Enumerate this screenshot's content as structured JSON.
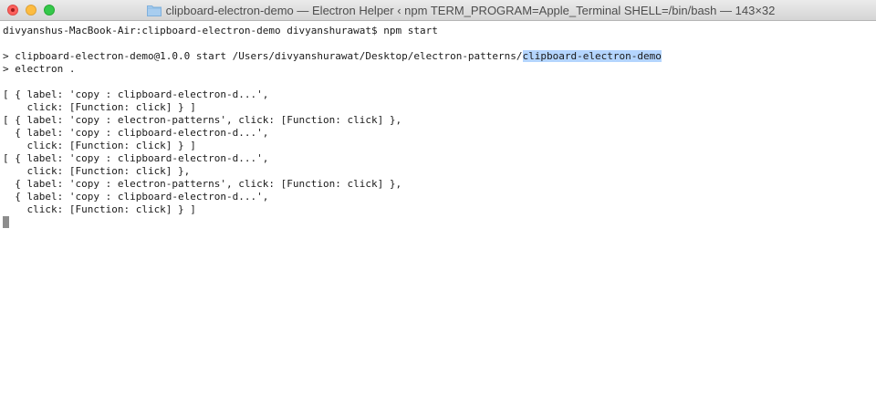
{
  "window": {
    "title": "clipboard-electron-demo — Electron Helper ‹ npm TERM_PROGRAM=Apple_Terminal SHELL=/bin/bash — 143×32"
  },
  "terminal": {
    "prompt_line": "divyanshus-MacBook-Air:clipboard-electron-demo divyanshurawat$ npm start",
    "start_prefix": "> clipboard-electron-demo@1.0.0 start /Users/divyanshurawat/Desktop/electron-patterns/",
    "start_highlight": "clipboard-electron-demo",
    "electron_line": "> electron .",
    "output": [
      "[ { label: 'copy : clipboard-electron-d...',",
      "    click: [Function: click] } ]",
      "[ { label: 'copy : electron-patterns', click: [Function: click] },",
      "  { label: 'copy : clipboard-electron-d...',",
      "    click: [Function: click] } ]",
      "[ { label: 'copy : clipboard-electron-d...',",
      "    click: [Function: click] },",
      "  { label: 'copy : electron-patterns', click: [Function: click] },",
      "  { label: 'copy : clipboard-electron-d...',",
      "    click: [Function: click] } ]"
    ]
  },
  "colors": {
    "selection": "#b4d5fe",
    "close": "#fc605c",
    "minimize": "#fdbc40",
    "maximize": "#34c84a"
  },
  "icons": [
    "folder-icon"
  ]
}
